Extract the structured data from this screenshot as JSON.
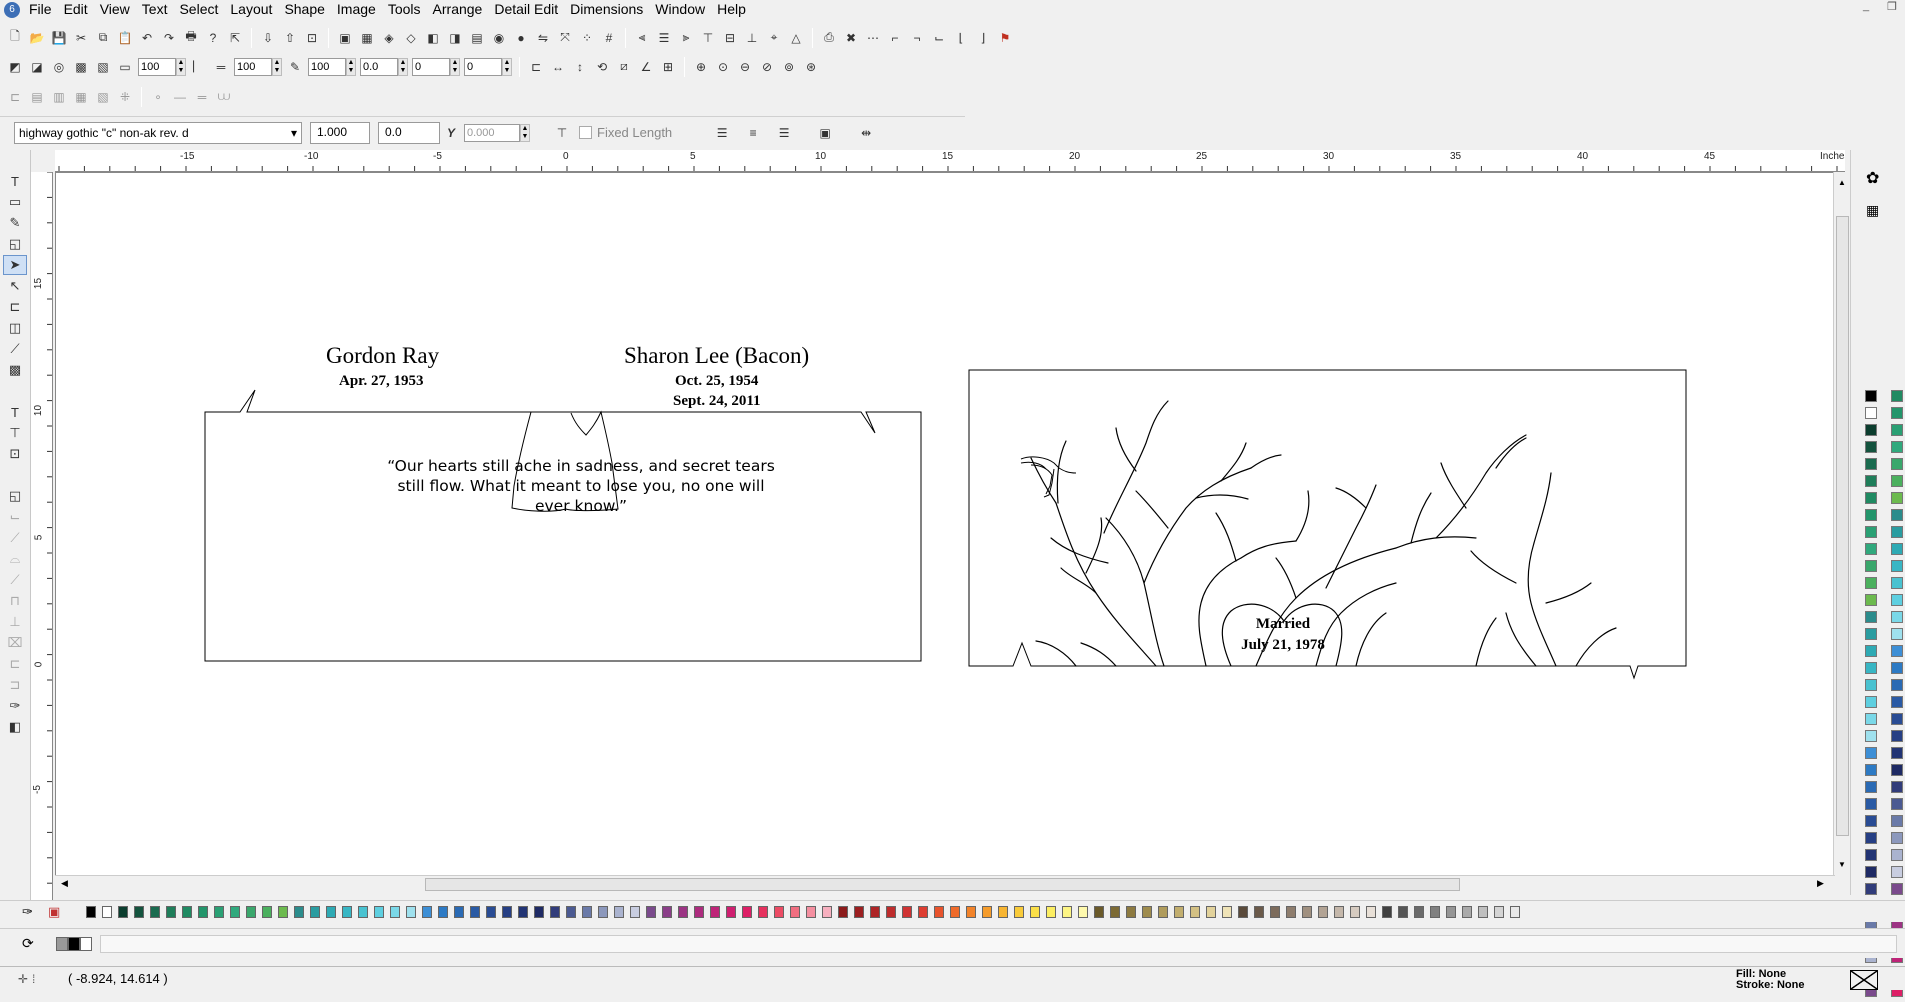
{
  "app": {
    "icon_text": "6"
  },
  "menu": [
    "File",
    "Edit",
    "View",
    "Text",
    "Select",
    "Layout",
    "Shape",
    "Image",
    "Tools",
    "Arrange",
    "Detail Edit",
    "Dimensions",
    "Window",
    "Help"
  ],
  "toolbar2": {
    "v1": "100",
    "v2": "100",
    "v3": "100",
    "v4": "0.0",
    "v5": "0",
    "v6": "0"
  },
  "textbar": {
    "font": "highway gothic \"c\" non-ak rev. d",
    "size": "1.000",
    "spacing": "0.0",
    "slant": "0.000",
    "fixed_length": "Fixed Length"
  },
  "ruler": {
    "units": "Inches",
    "h_labels": [
      "-15",
      "-10",
      "-5",
      "0",
      "5",
      "10",
      "15",
      "20",
      "25",
      "30",
      "35",
      "40",
      "45"
    ],
    "v_labels": [
      "15",
      "10",
      "5",
      "0",
      "-5"
    ]
  },
  "panel_left": {
    "name1": "Gordon Ray",
    "date1": "Apr. 27, 1953",
    "name2": "Sharon Lee (Bacon)",
    "date2a": "Oct. 25, 1954",
    "date2b": "Sept. 24, 2011",
    "quote_l1": "“Our hearts still ache in sadness, and secret tears",
    "quote_l2": "still flow.  What it meant to lose you, no one will",
    "quote_l3": "ever know.”"
  },
  "panel_right": {
    "married": "Married",
    "married_date": "July 21, 1978"
  },
  "status": {
    "coords": "( -8.924, 14.614 )",
    "fill": "Fill: None",
    "stroke": "Stroke: None"
  },
  "colors": {
    "palette": [
      "#000000",
      "#ffffff",
      "#0b3d2e",
      "#14533e",
      "#1a6b4f",
      "#1f7e5a",
      "#208a62",
      "#23956b",
      "#2aa074",
      "#30a97d",
      "#3aa76c",
      "#4bb05e",
      "#6cba4e",
      "#2b8c8c",
      "#2a9ca0",
      "#2eaab4",
      "#38b6c4",
      "#49c2d0",
      "#5ecfe0",
      "#7ad8e8",
      "#9fe1ee",
      "#3d8fd6",
      "#2d7ac4",
      "#2a6ab4",
      "#2a5aa4",
      "#294c94",
      "#263f84",
      "#223474",
      "#1e2a64",
      "#313c7a",
      "#4b5a92",
      "#6a7aa8",
      "#8c98bc",
      "#aab3cf",
      "#c8cde0",
      "#7a4a8c",
      "#8a3e88",
      "#9c3484",
      "#ad2b7e",
      "#be2478",
      "#cf1f70",
      "#dd1f66",
      "#e5315e",
      "#ec4b64",
      "#f06e80",
      "#f48fa0",
      "#f7b0bf",
      "#8b1a1a",
      "#9c1f20",
      "#ad2526",
      "#be2c2c",
      "#cf3333",
      "#dd3d31",
      "#e8532c",
      "#ee6a2a",
      "#f2832a",
      "#f59c2c",
      "#f7b532",
      "#f9cb3a",
      "#fbdf48",
      "#fcee62",
      "#fdf585",
      "#fef9ad",
      "#6b5a2a",
      "#7c6a34",
      "#8d7a40",
      "#9e8b4d",
      "#b09c5c",
      "#c2ae6e",
      "#d3c083",
      "#e2d29b",
      "#efe3b7",
      "#5a4a3a",
      "#6b5a4a",
      "#7c6b5b",
      "#8e7d6d",
      "#a09080",
      "#b2a394",
      "#c4b7aa",
      "#d6cbc0",
      "#e8e0d8",
      "#404040",
      "#555555",
      "#6a6a6a",
      "#808080",
      "#959595",
      "#aaaaaa",
      "#bfbfbf",
      "#d4d4d4",
      "#e9e9e9"
    ]
  }
}
